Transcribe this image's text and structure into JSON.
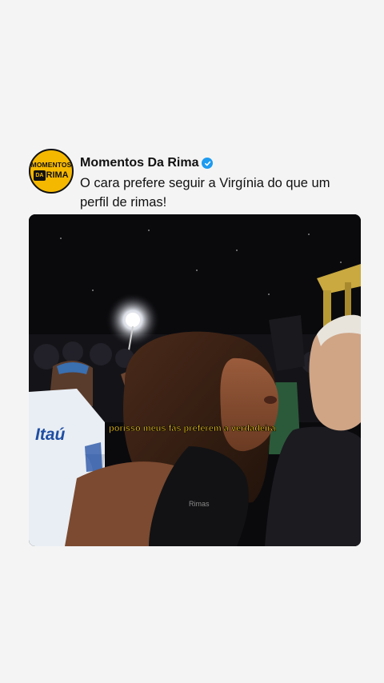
{
  "post": {
    "avatar": {
      "line1": "MOMENTOS",
      "line2a": "DA",
      "line2b": "RIMA"
    },
    "author": "Momentos Da Rima",
    "verified": true,
    "caption": "O cara prefere seguir a Virgínia do que um perfil de rimas!",
    "media": {
      "jersey_text": "Itaú",
      "subtitle_text": "porisso meus fãs preferem a verdadeira",
      "shirt_watermark": "Rimas"
    }
  },
  "colors": {
    "brand_yellow": "#f5b800",
    "verified_blue": "#1d9bf0",
    "background": "#f4f4f4"
  }
}
